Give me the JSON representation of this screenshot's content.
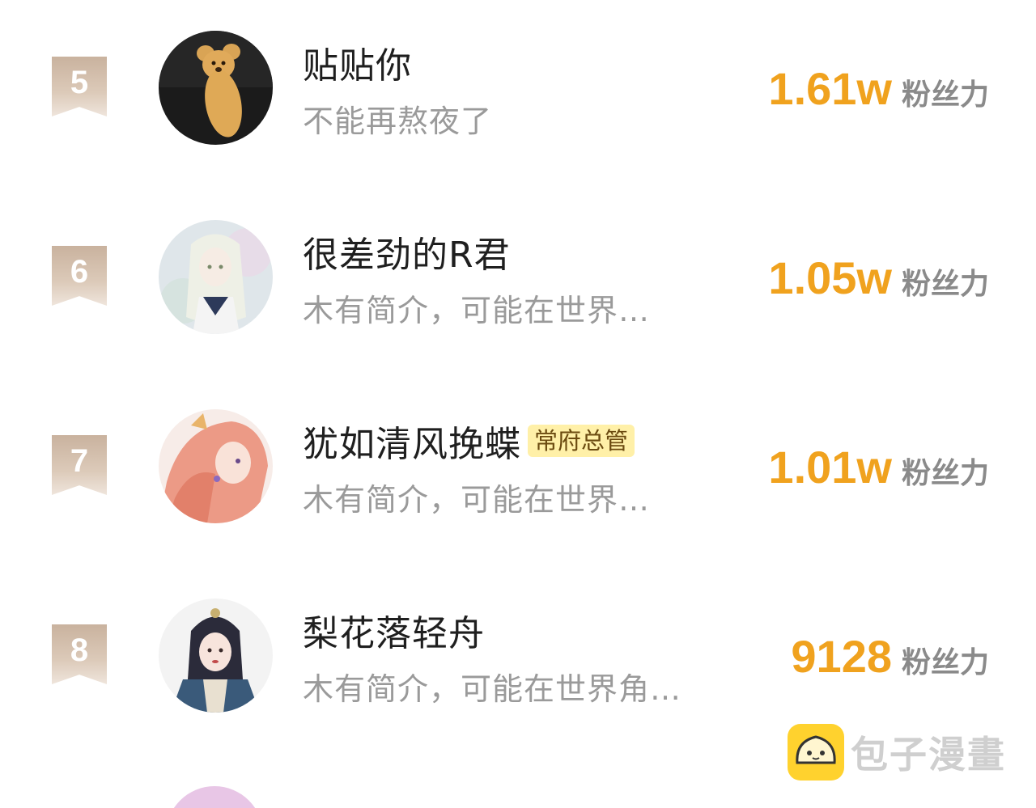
{
  "fans_label": "粉丝力",
  "entries": [
    {
      "rank": "5",
      "name": "贴贴你",
      "badge": "",
      "bio": "不能再熬夜了",
      "fans": "1.61w",
      "avatar": "koala-plush-avatar"
    },
    {
      "rank": "6",
      "name": "很差劲的R君",
      "badge": "",
      "bio": "木有简介，可能在世界…",
      "fans": "1.05w",
      "avatar": "white-hair-anime-girl-avatar"
    },
    {
      "rank": "7",
      "name": "犹如清风挽蝶",
      "badge": "常府总管",
      "bio": "木有简介，可能在世界…",
      "fans": "1.01w",
      "avatar": "pink-hair-anime-avatar"
    },
    {
      "rank": "8",
      "name": "梨花落轻舟",
      "badge": "",
      "bio": "木有简介，可能在世界角…",
      "fans": "9128",
      "avatar": "ancient-costume-girl-avatar"
    }
  ],
  "watermark": {
    "text": "包子漫畫",
    "icon": "baozi-bun-icon",
    "color": "#ffd22e"
  },
  "colors": {
    "fans_value": "#f0a21e",
    "rank_badge": "#c9b29e",
    "title_badge_bg": "#fff0a8"
  }
}
